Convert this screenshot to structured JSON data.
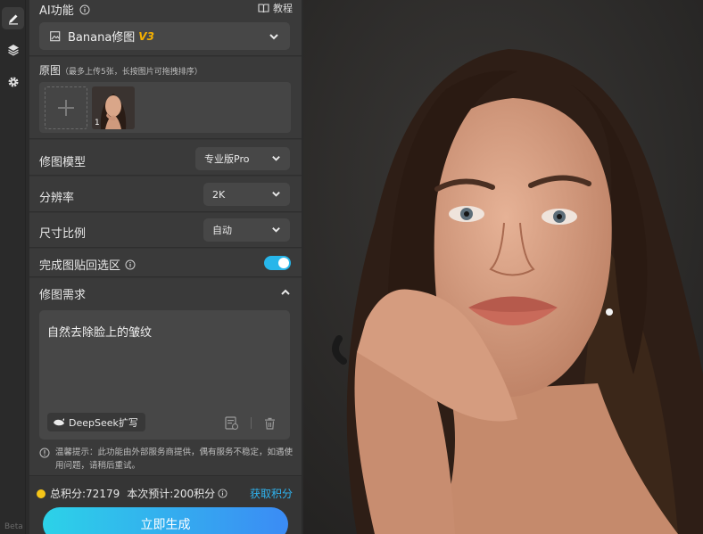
{
  "rail": {
    "beta_label": "Beta"
  },
  "ai": {
    "title": "AI功能",
    "tutorial_label": "教程",
    "model_name": "Banana修图",
    "model_version": "V3"
  },
  "source": {
    "title": "原图",
    "hint": "（最多上传5张，长按图片可拖拽排序）",
    "thumb_index": "1"
  },
  "settings": {
    "model_label": "修图模型",
    "model_value": "专业版Pro",
    "resolution_label": "分辨率",
    "resolution_value": "2K",
    "ratio_label": "尺寸比例",
    "ratio_value": "自动",
    "paste_back_label": "完成图贴回选区",
    "paste_back_enabled": true
  },
  "request": {
    "title": "修图需求",
    "text": "自然去除脸上的皱纹",
    "deepseek_label": "DeepSeek扩写"
  },
  "notice": {
    "text": "温馨提示：此功能由外部服务商提供，偶有服务不稳定，如遇使用问题，请稍后重试。"
  },
  "footer": {
    "total_points": "总积分:72179",
    "estimate": "本次预计:200积分",
    "get_points": "获取积分",
    "generate_label": "立即生成"
  },
  "colors": {
    "accent": "#27b6ea",
    "version_badge": "#f5b000",
    "panel": "#3a3a3a"
  }
}
